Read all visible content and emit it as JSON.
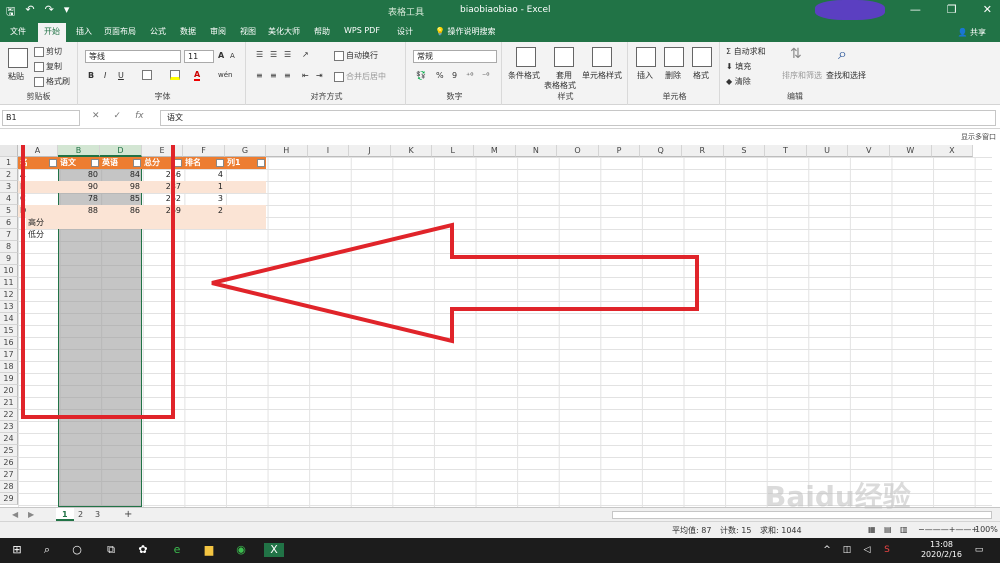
{
  "titlebar": {
    "context_label": "表格工具",
    "title": "biaobiaobiao  -  Excel",
    "minimize": "—",
    "restore": "❐",
    "close": "✕"
  },
  "tabs": [
    "文件",
    "开始",
    "插入",
    "页面布局",
    "公式",
    "数据",
    "审阅",
    "视图",
    "美化大师",
    "帮助",
    "WPS PDF",
    "设计"
  ],
  "active_tab": "开始",
  "tell_me": "操作说明搜索",
  "share": "共享",
  "ribbon": {
    "clipboard": {
      "paste": "粘贴",
      "cut": "剪切",
      "copy": "复制",
      "format_painter": "格式刷",
      "label": "剪贴板"
    },
    "font": {
      "name": "等线",
      "size": "11",
      "bold": "B",
      "italic": "I",
      "underline": "U",
      "grow": "A",
      "shrink": "A",
      "label": "字体",
      "color_letter": "A",
      "phonetic": "wén"
    },
    "alignment": {
      "wrap": "自动换行",
      "merge": "合并后居中",
      "label": "对齐方式"
    },
    "number": {
      "format": "常规",
      "percent": "%",
      "comma": "9",
      "label": "数字"
    },
    "styles": {
      "conditional": "条件格式",
      "table_format_a": "套用",
      "table_format_b": "表格格式",
      "cell_styles": "单元格样式",
      "label": "样式"
    },
    "cells": {
      "insert": "插入",
      "delete": "删除",
      "format": "格式",
      "label": "单元格"
    },
    "editing": {
      "autosum": "自动求和",
      "fill": "填充",
      "clear": "清除",
      "sort": "排序和筛选",
      "find": "查找和选择",
      "label": "编辑"
    }
  },
  "formula_bar": {
    "name_box": "B1",
    "cancel": "✕",
    "enter": "✓",
    "fx": "fx",
    "content": "语文"
  },
  "display_note": "显示多窗口",
  "columns": [
    "A",
    "B",
    "D",
    "E",
    "F",
    "G",
    "H",
    "I",
    "J",
    "K",
    "L",
    "M",
    "N",
    "O",
    "P",
    "Q",
    "R",
    "S",
    "T",
    "U",
    "V",
    "W",
    "X"
  ],
  "rows": [
    "1",
    "2",
    "3",
    "4",
    "5",
    "6",
    "7",
    "8",
    "9",
    "10",
    "11",
    "12",
    "13",
    "14",
    "15",
    "16",
    "17",
    "18",
    "19",
    "20",
    "21",
    "22",
    "23",
    "24",
    "25",
    "26",
    "27",
    "28",
    "29"
  ],
  "table": {
    "headers": [
      "名",
      "语文",
      "英语",
      "总分",
      "排名",
      "列1"
    ],
    "rows": [
      [
        "A",
        "80",
        "84",
        "246",
        "4"
      ],
      [
        "B",
        "90",
        "98",
        "287",
        "1"
      ],
      [
        "C",
        "78",
        "85",
        "262",
        "3"
      ],
      [
        "D",
        "88",
        "86",
        "269",
        "2"
      ]
    ],
    "extra": [
      "高分",
      "低分"
    ]
  },
  "sheets": [
    "1",
    "2",
    "3"
  ],
  "active_sheet": "1",
  "add_sheet": "+",
  "status": {
    "average": "平均值: 87",
    "count": "计数: 15",
    "sum": "求和: 1044",
    "zoom": "100%"
  },
  "taskbar": {
    "time": "13:08",
    "date": "2020/2/16"
  },
  "watermark": "Baidu经验",
  "colors": {
    "excel_green": "#217346",
    "table_header": "#ed7d31",
    "table_band": "#fbe4d5",
    "annotation_red": "#e0242a"
  }
}
